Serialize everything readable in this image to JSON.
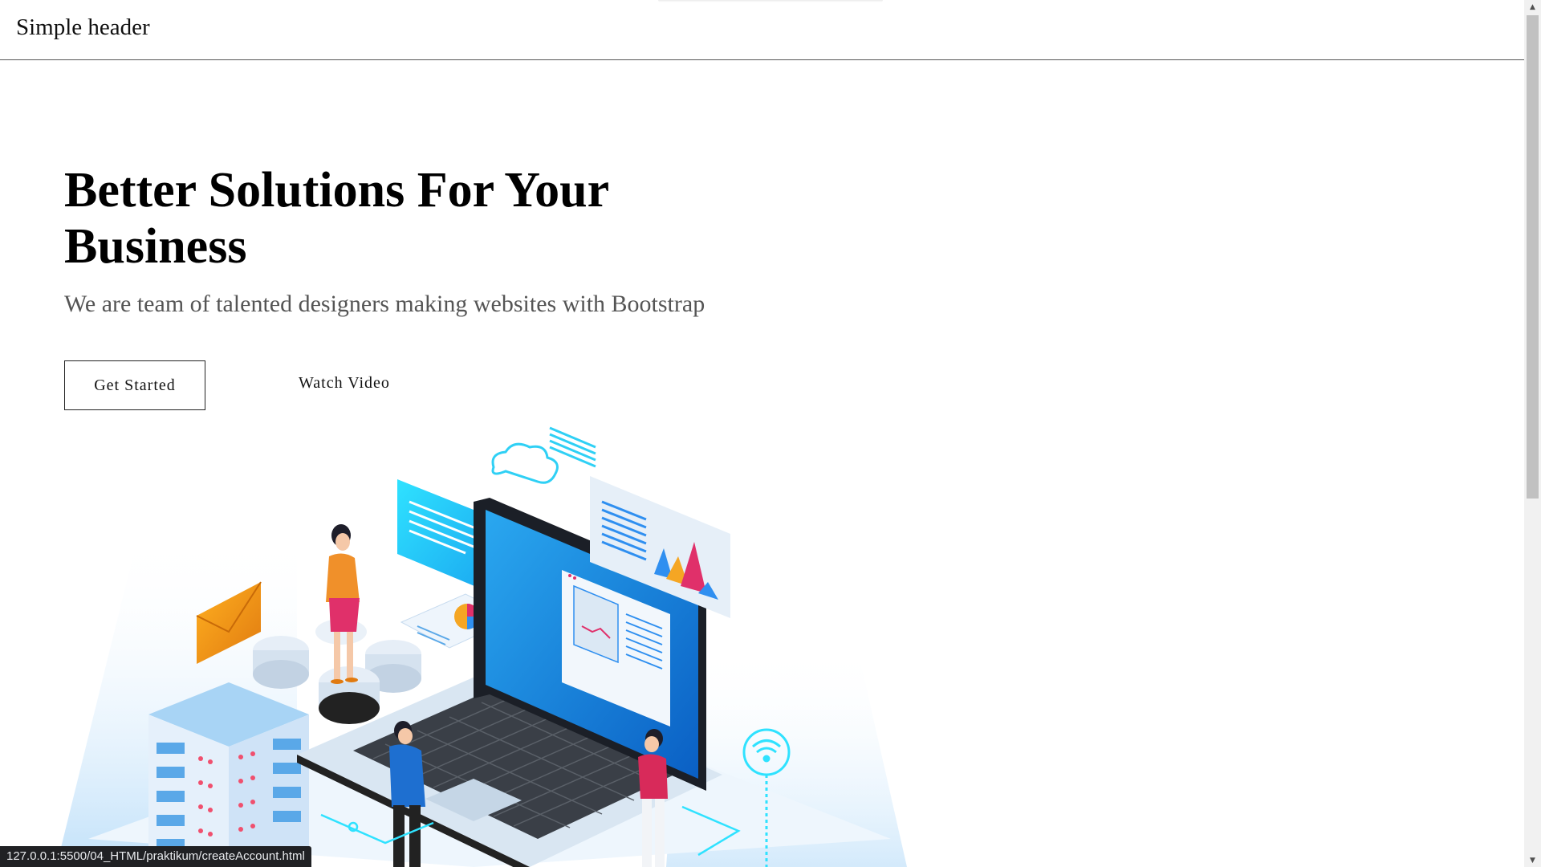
{
  "header": {
    "brand": "Simple header"
  },
  "hero": {
    "title": "Better Solutions For Your Business",
    "subtitle": "We are team of talented designers making websites with Bootstrap",
    "primary_button": "Get Started",
    "secondary_button": "Watch Video"
  },
  "browser": {
    "status_url": "127.0.0.1:5500/04_HTML/praktikum/createAccount.html"
  },
  "colors": {
    "accent_blue": "#1e88e5",
    "accent_cyan": "#2fd0f5",
    "accent_orange": "#f0a020",
    "accent_pink": "#e0305a",
    "status_bar_bg": "#202124"
  },
  "icons": {
    "scroll_up": "triangle-up-icon",
    "scroll_down": "triangle-down-icon"
  }
}
